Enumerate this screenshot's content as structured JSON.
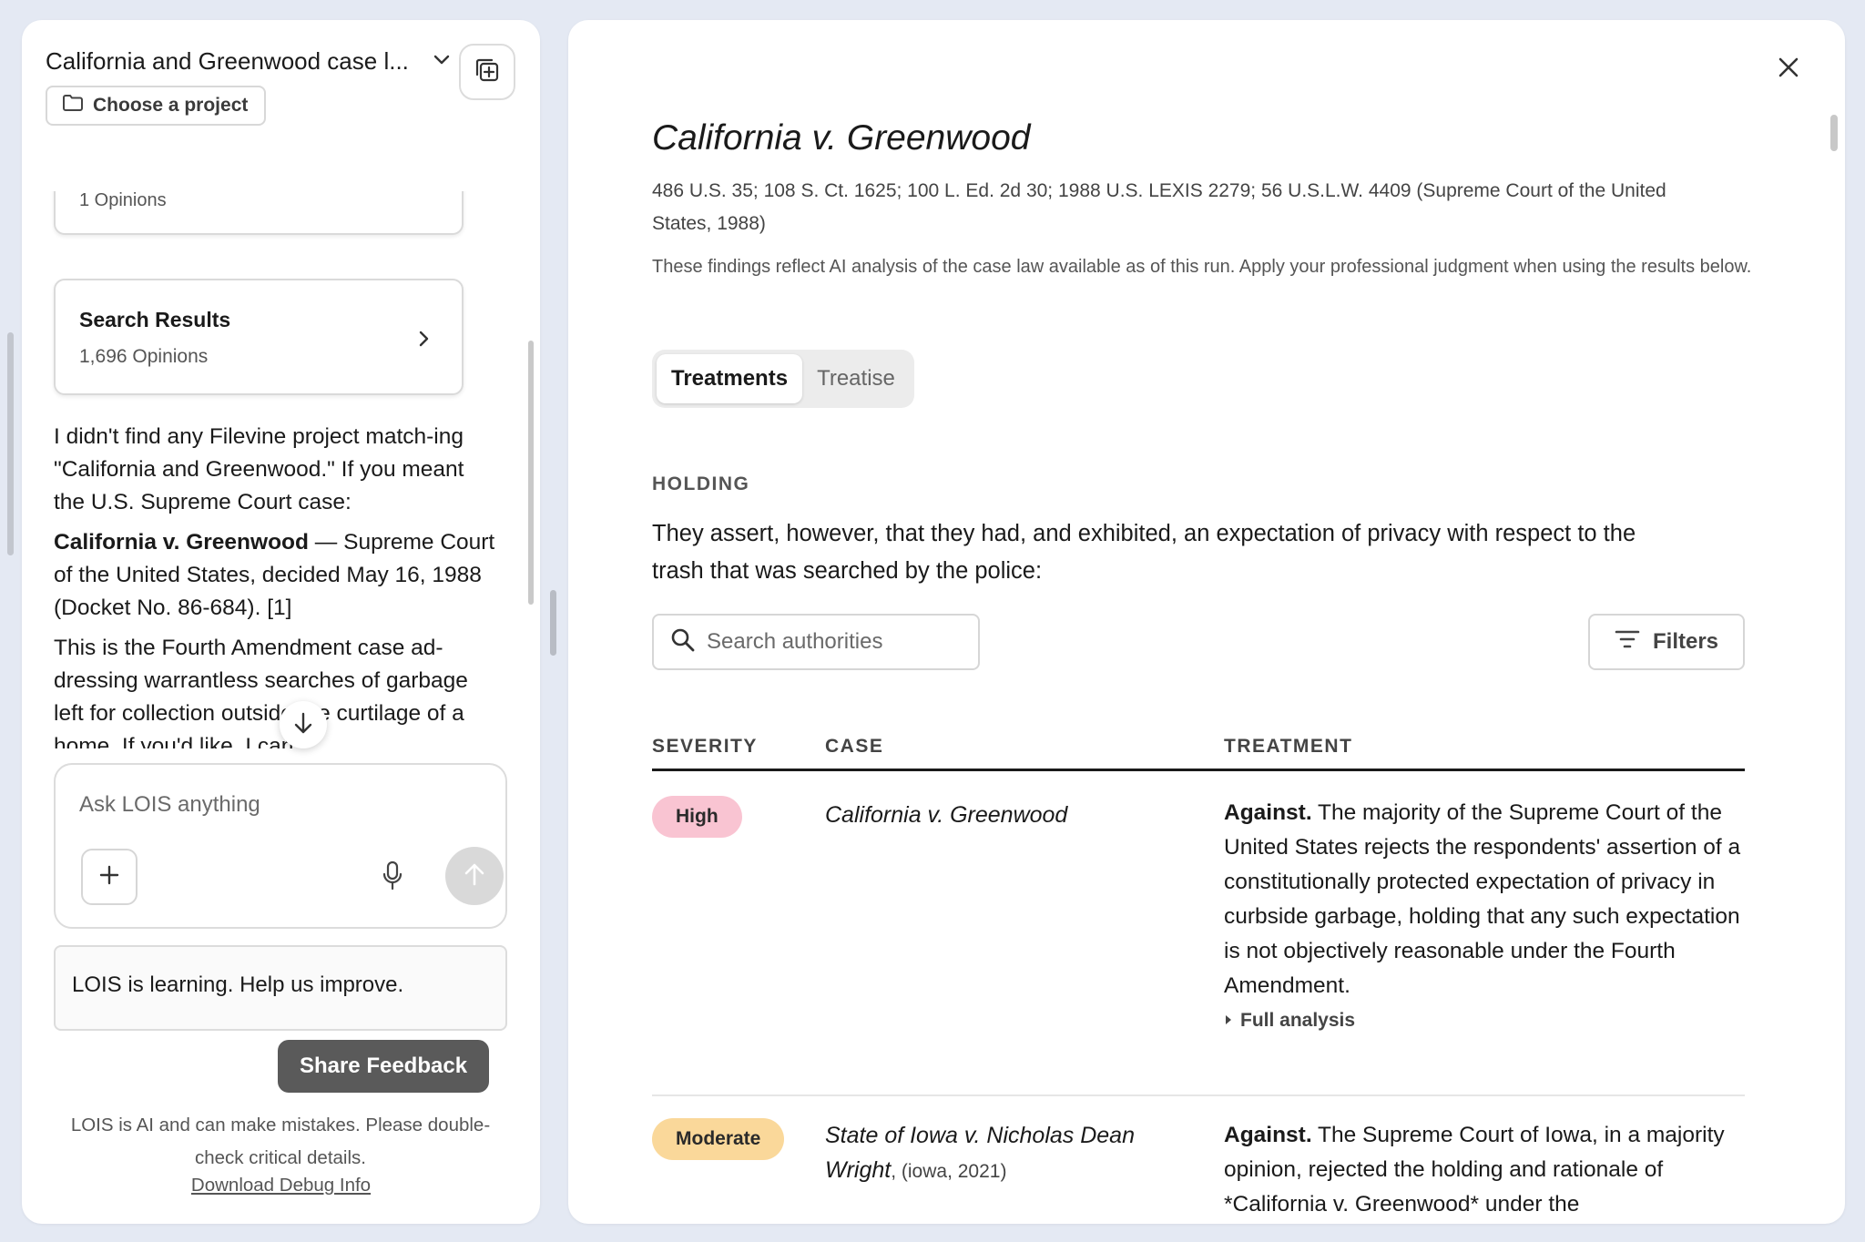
{
  "sidebar": {
    "conversation_title": "California and Greenwood case l...",
    "choose_project_label": "Choose a project",
    "top_card_sub": "1 Opinions",
    "search_card": {
      "title": "Search Results",
      "count": "1,696 Opinions"
    },
    "messages": {
      "p1": "I didn't find any Filevine project match-ing \"California and Greenwood.\" If you meant the U.S. Supreme Court case:",
      "p2_bold": "California v. Greenwood",
      "p2_rest": " — Supreme Court of the United States, decided May 16, 1988 (Docket No. 86-684). [1]",
      "p3": "This is the Fourth Amendment case ad-dressing warrantless searches of garbage left for collection outside the curtilage of a home. If you'd like, I can"
    },
    "composer_placeholder": "Ask LOIS anything",
    "feedback_prompt": "LOIS is learning. Help us improve.",
    "share_feedback_label": "Share Feedback",
    "disclaimer": "LOIS is AI and can make mistakes. Please double-check critical details.",
    "debug_link": "Download Debug Info"
  },
  "detail": {
    "case_title": "California v. Greenwood",
    "citation": "486 U.S. 35; 108 S. Ct. 1625; 100 L. Ed. 2d 30; 1988 U.S. LEXIS 2279; 56 U.S.L.W. 4409 (Supreme Court of the United States, 1988)",
    "ai_note": "These findings reflect AI analysis of the case law available as of this run. Apply your professional judgment when using the results below.",
    "tabs": [
      {
        "label": "Treatments",
        "active": true
      },
      {
        "label": "Treatise",
        "active": false
      }
    ],
    "holding_label": "HOLDING",
    "holding_text": "They assert, however, that they had, and exhibited, an expectation of privacy with respect to the trash that was searched by the police:",
    "search_placeholder": "Search authorities",
    "filters_label": "Filters",
    "columns": {
      "severity": "SEVERITY",
      "case": "CASE",
      "treatment": "TREATMENT"
    },
    "rows": [
      {
        "severity": "High",
        "case": "California v. Greenwood",
        "case_meta": "",
        "treatment_lead": "Against.",
        "treatment_text": " The majority of the Supreme Court of the United States rejects the respondents' assertion of a constitutionally protected expectation of privacy in curbside garbage, holding that any such expectation is not objectively reasonable under the Fourth Amendment.",
        "full_analysis": "Full analysis"
      },
      {
        "severity": "Moderate",
        "case": "State of Iowa v. Nicholas Dean Wright",
        "case_meta": ", (iowa, 2021)",
        "treatment_lead": "Against.",
        "treatment_text": " The Supreme Court of Iowa, in a majority opinion, rejected the holding and rationale of *California v. Greenwood* under the"
      }
    ]
  },
  "colors": {
    "badge_high": "#f9c4d2",
    "badge_moderate": "#fad89a",
    "share_button": "#5a5a5a",
    "page_bg": "#e4e9f3"
  }
}
